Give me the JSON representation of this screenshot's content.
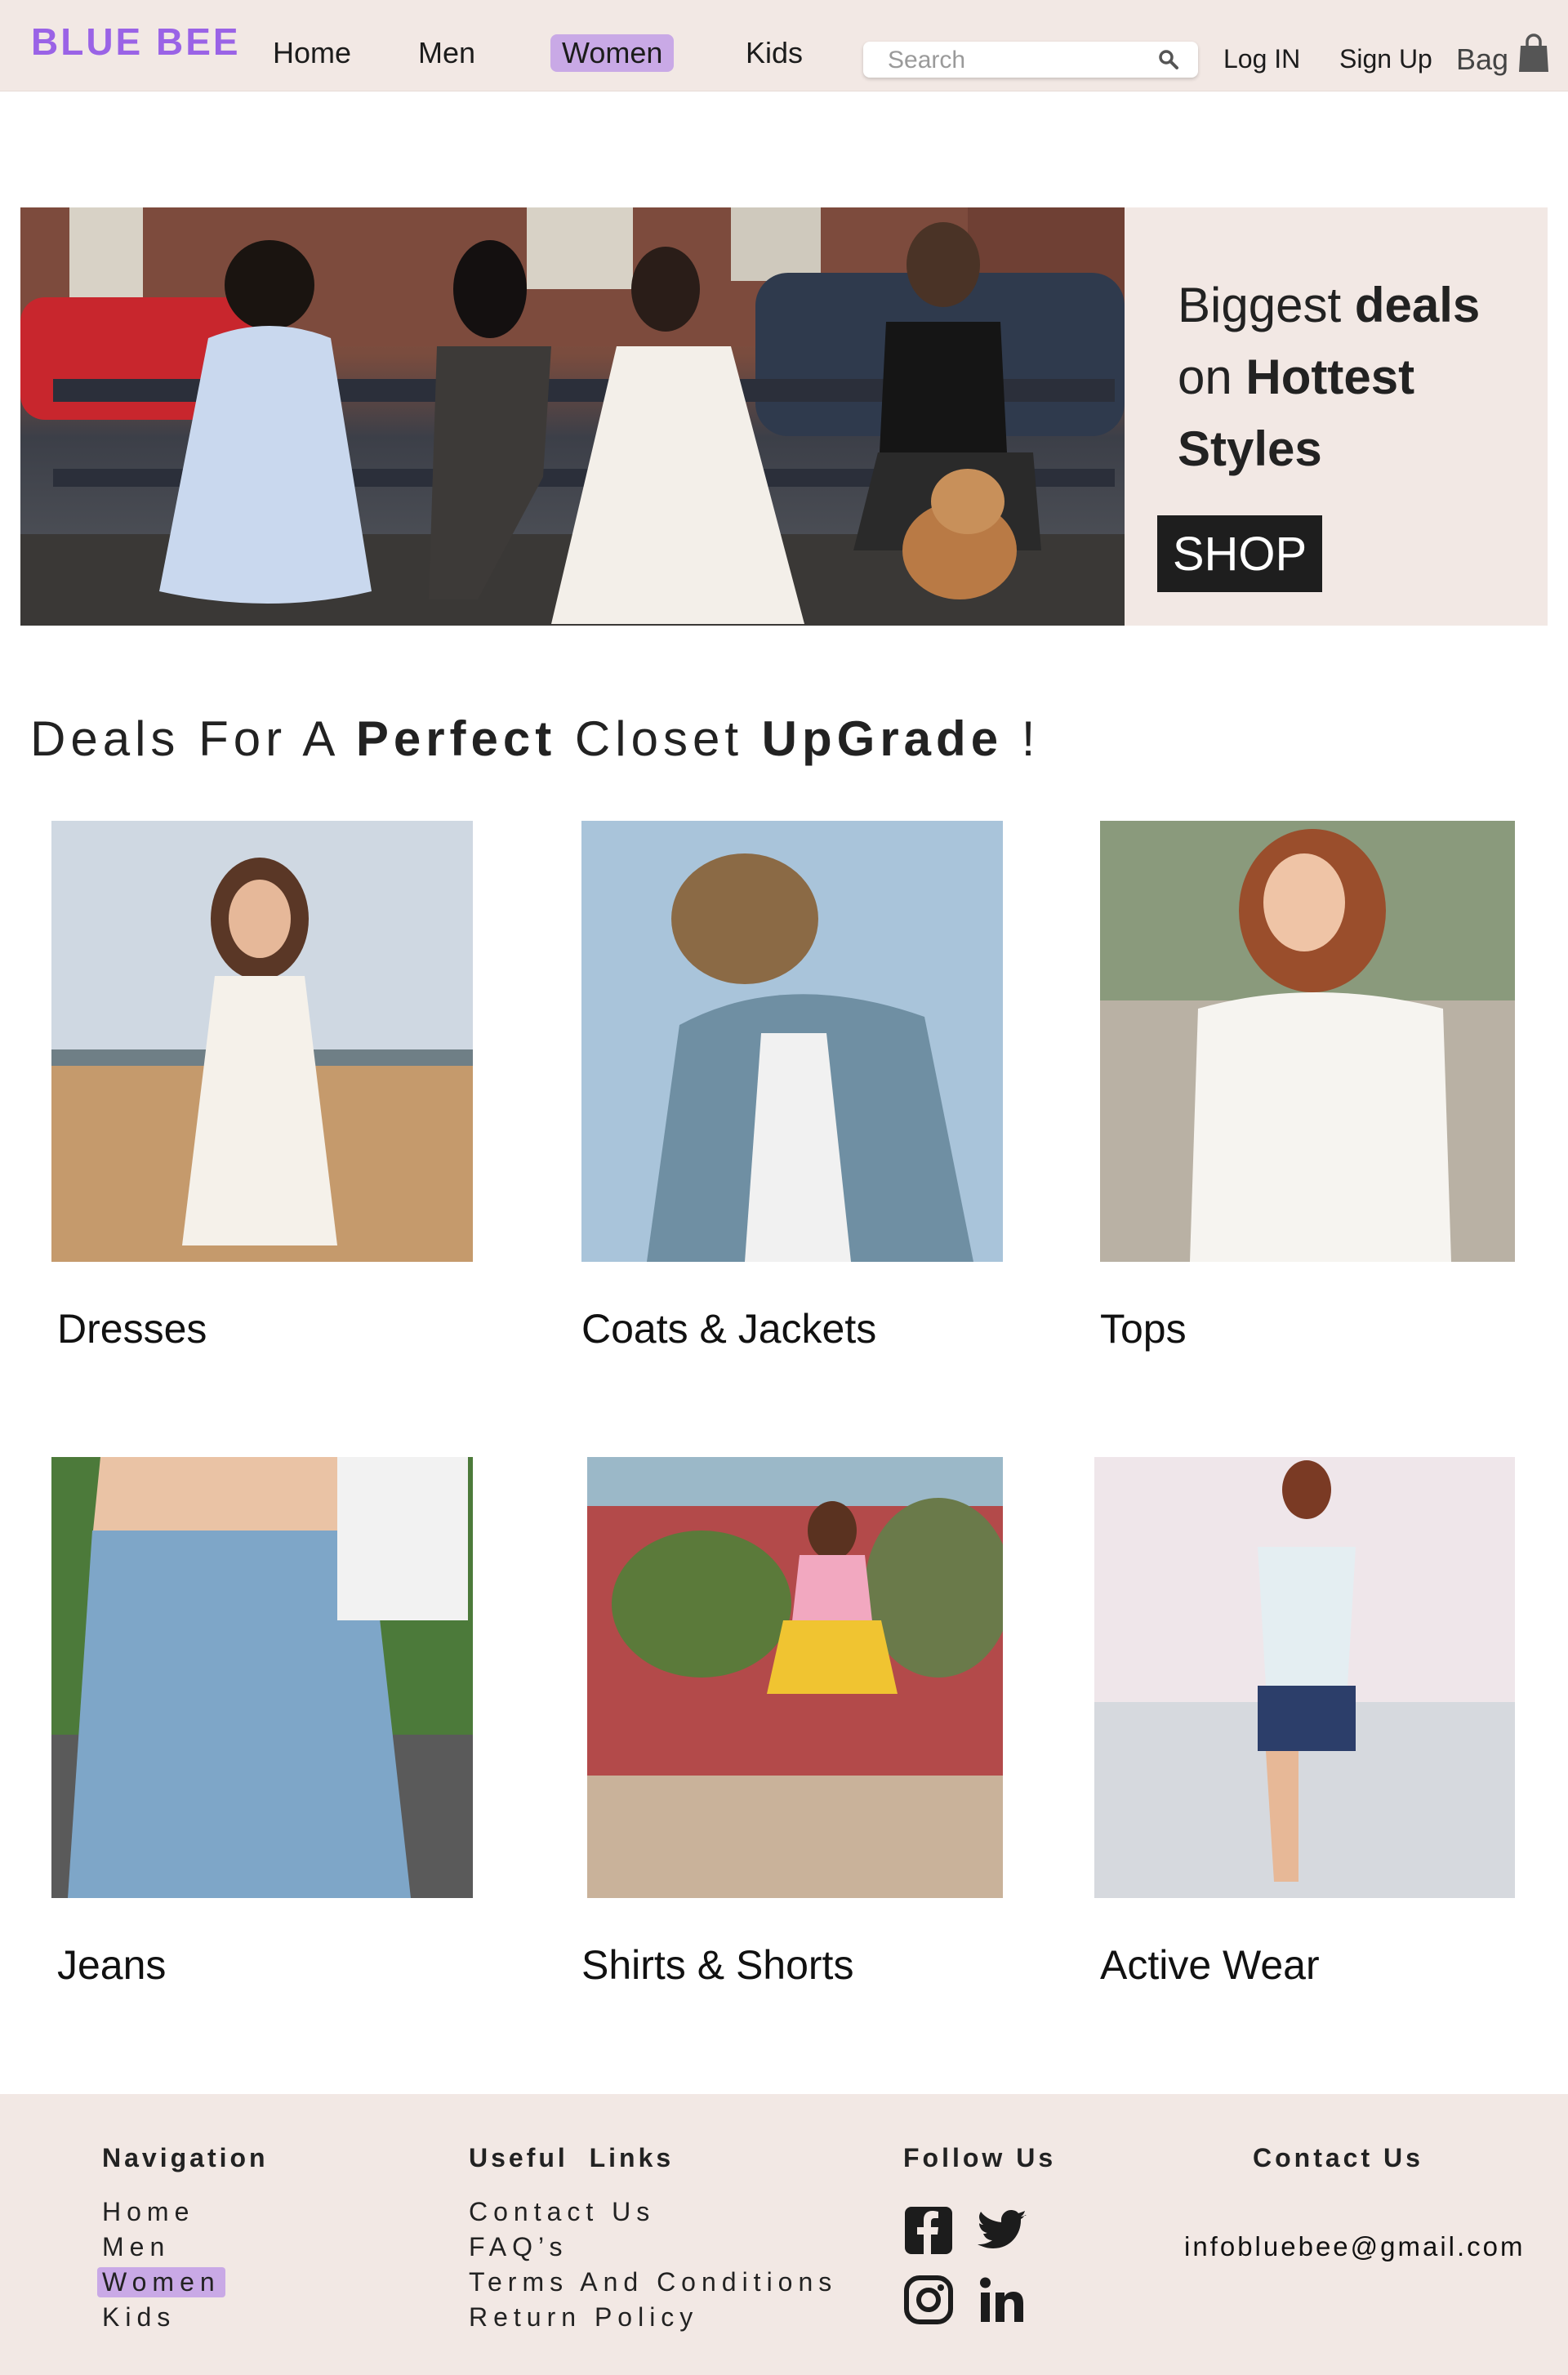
{
  "brand": {
    "name": "BLUE BEE",
    "color": "#9a63e6"
  },
  "nav": {
    "items": [
      {
        "label": "Home"
      },
      {
        "label": "Men"
      },
      {
        "label": "Women",
        "active": true
      },
      {
        "label": "Kids"
      }
    ],
    "search": {
      "placeholder": "Search",
      "icon": "search-icon"
    },
    "login": "Log IN",
    "signup": "Sign Up",
    "bag": {
      "label": "Bag",
      "icon": "shopping-bag-icon"
    }
  },
  "hero": {
    "line1_light": "Biggest",
    "line1_bold": "deals",
    "line2_light": "on",
    "line2_bold": "Hottest",
    "line3_bold": "Styles",
    "shop_label": "SHOP"
  },
  "deals_heading": {
    "part1": "Deals For A",
    "bold1": "Perfect",
    "part2": "Closet",
    "bold2": "UpGrade",
    "end": "!"
  },
  "categories": [
    {
      "label": "Dresses"
    },
    {
      "label": "Coats & Jackets"
    },
    {
      "label": "Tops"
    },
    {
      "label": "Jeans"
    },
    {
      "label": "Shirts & Shorts"
    },
    {
      "label": "Active Wear"
    }
  ],
  "footer": {
    "navigation": {
      "heading": "Navigation",
      "links": [
        "Home",
        "Men",
        "Women",
        "Kids"
      ],
      "active": "Women"
    },
    "useful_links": {
      "heading": "Useful  Links",
      "links": [
        "Contact Us",
        "FAQ’s",
        "Terms And Conditions",
        "Return Policy"
      ]
    },
    "follow_us": {
      "heading": "Follow Us",
      "icons": [
        "facebook-icon",
        "twitter-icon",
        "instagram-icon",
        "linkedin-icon"
      ]
    },
    "contact_us": {
      "heading": "Contact Us",
      "email": "infobluebee@gmail.com"
    }
  },
  "colors": {
    "nav_background": "#f2e8e4",
    "active_highlight": "#c9a9e6",
    "shop_button": "#1e1e1e"
  }
}
